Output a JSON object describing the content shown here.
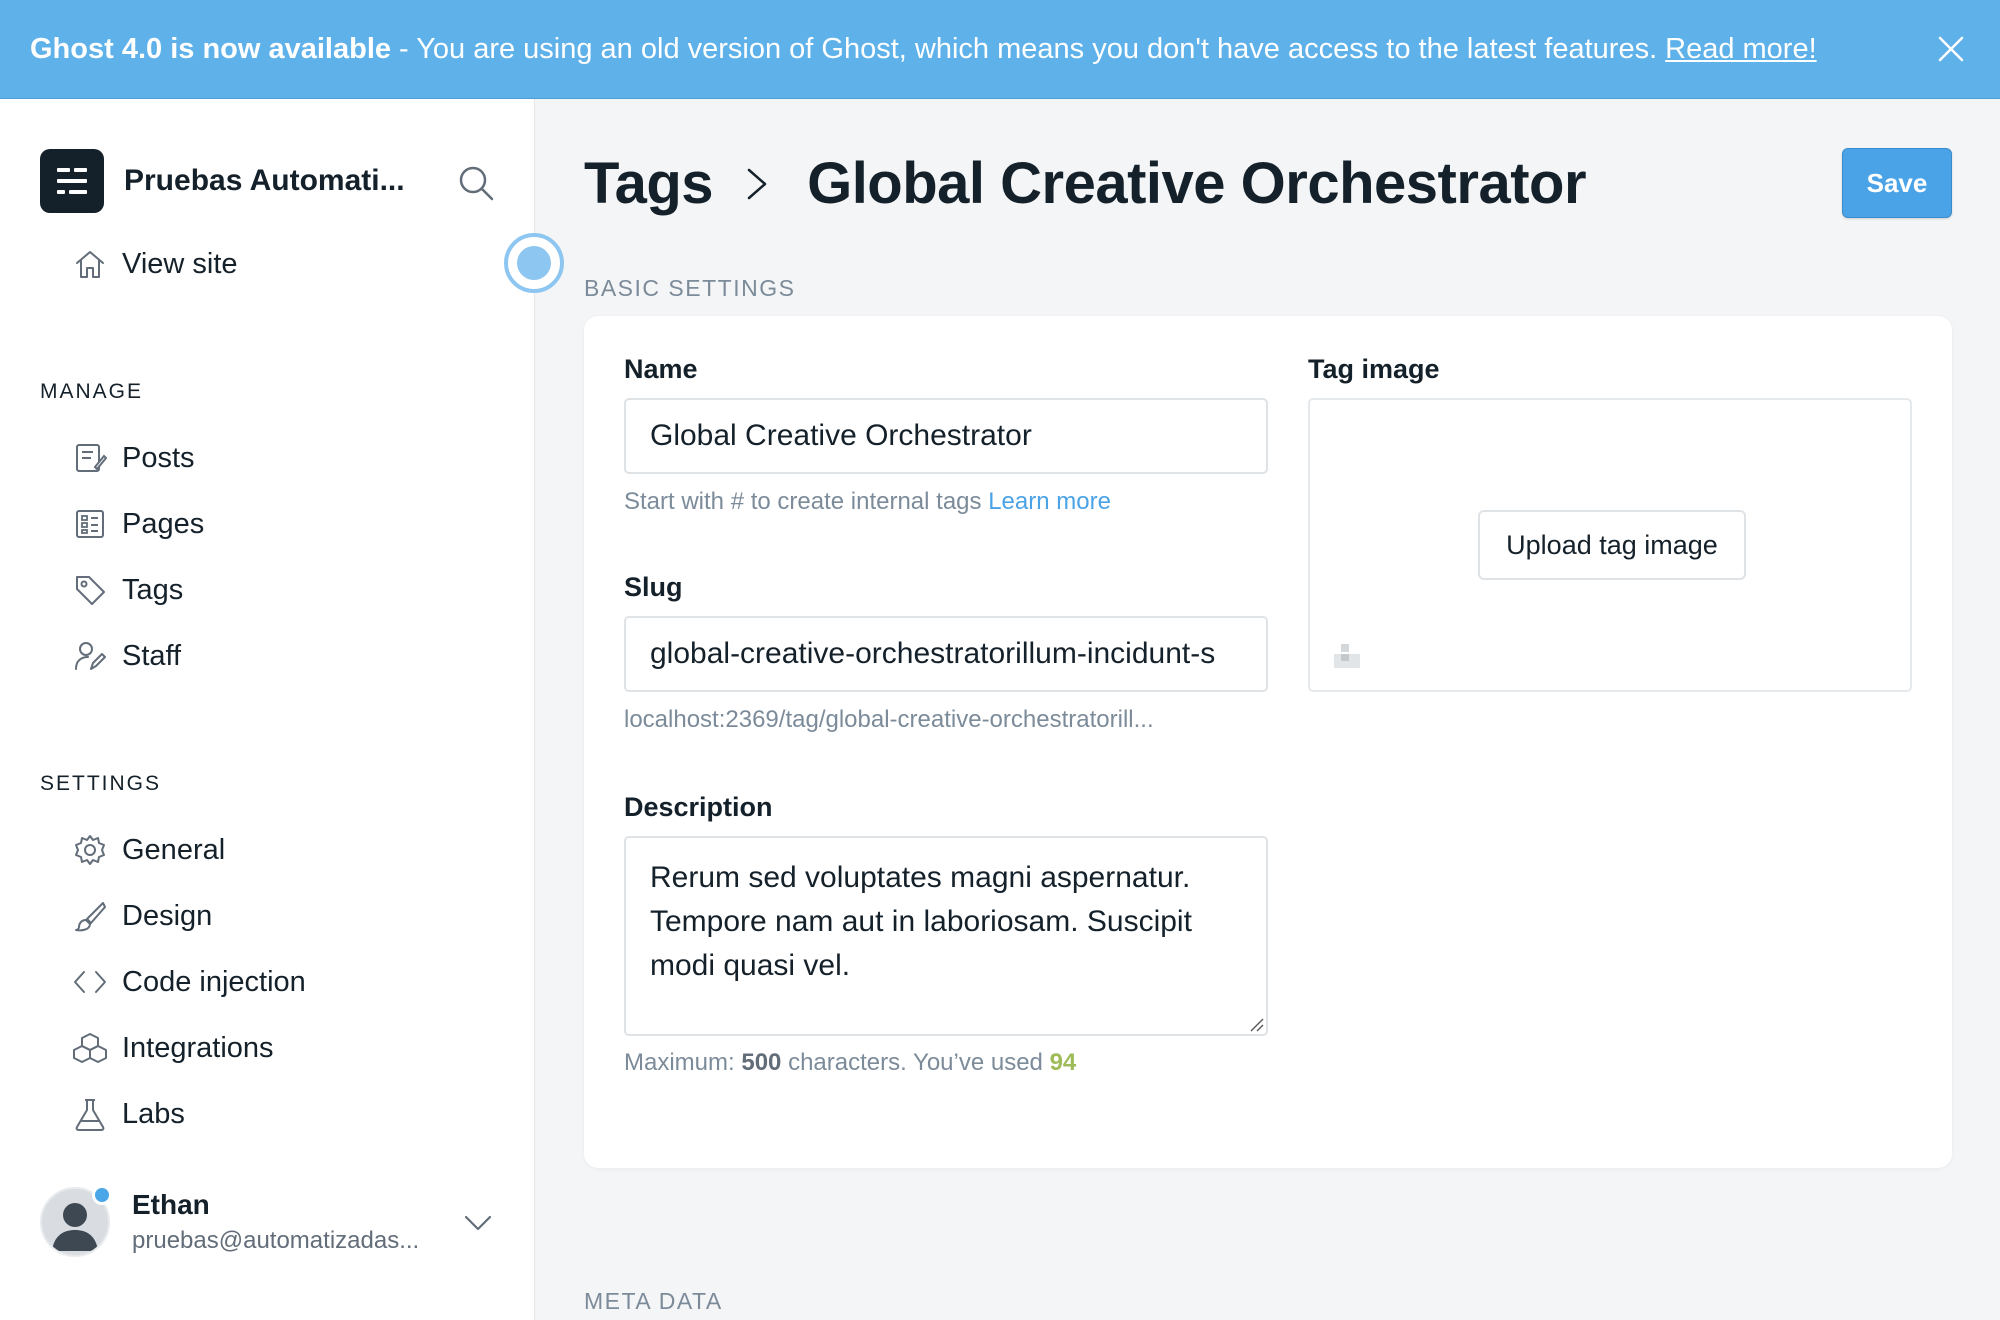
{
  "banner": {
    "title": "Ghost 4.0 is now available",
    "message": "- You are using an old version of Ghost, which means you don't have access to the latest features.",
    "link": "Read more!"
  },
  "sidebar": {
    "site_name": "Pruebas Automati...",
    "view_site": "View site",
    "manage_label": "MANAGE",
    "manage_items": [
      {
        "label": "Posts",
        "icon": "posts-icon"
      },
      {
        "label": "Pages",
        "icon": "pages-icon"
      },
      {
        "label": "Tags",
        "icon": "tag-icon"
      },
      {
        "label": "Staff",
        "icon": "staff-icon"
      }
    ],
    "settings_label": "SETTINGS",
    "settings_items": [
      {
        "label": "General",
        "icon": "gear-icon"
      },
      {
        "label": "Design",
        "icon": "brush-icon"
      },
      {
        "label": "Code injection",
        "icon": "code-icon"
      },
      {
        "label": "Integrations",
        "icon": "integrations-icon"
      },
      {
        "label": "Labs",
        "icon": "flask-icon"
      }
    ],
    "user": {
      "name": "Ethan",
      "email": "pruebas@automatizadas..."
    }
  },
  "header": {
    "breadcrumb_parent": "Tags",
    "title": "Global Creative Orchestrator",
    "save_label": "Save"
  },
  "basic_settings": {
    "section_title": "BASIC SETTINGS",
    "name_label": "Name",
    "name_value": "Global Creative Orchestrator",
    "name_hint": "Start with # to create internal tags",
    "name_hint_link": "Learn more",
    "slug_label": "Slug",
    "slug_value": "global-creative-orchestratorillum-incidunt-s",
    "slug_url": "localhost:2369/tag/global-creative-orchestratorill...",
    "description_label": "Description",
    "description_value": "Rerum sed voluptates magni aspernatur. Tempore nam aut in laboriosam. Suscipit modi quasi vel.",
    "count_prefix": "Maximum:",
    "count_max": "500",
    "count_middle": "characters. You’ve used",
    "count_used": "94",
    "tag_image_label": "Tag image",
    "upload_label": "Upload tag image"
  },
  "meta_data": {
    "section_title": "META DATA"
  },
  "colors": {
    "banner": "#5fb1ea",
    "accent": "#4aa3e6",
    "count_used": "#9fbb58"
  }
}
